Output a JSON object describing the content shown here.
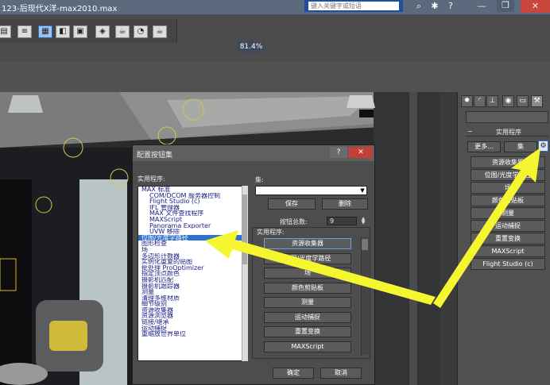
{
  "window": {
    "title_fragment": "123-后现代X洋-max2010.max",
    "search_placeholder": "键入关键字或短语"
  },
  "toolbar": {
    "zoom": "81.4%"
  },
  "command_panel": {
    "rollout_title": "实用程序",
    "more_label": "更多...",
    "sets_label": "集",
    "buttons": [
      "资源收集器",
      "位图/光度学路径",
      "场",
      "颜色剪贴板",
      "测量",
      "运动捕捉",
      "重置变换",
      "MAXScript",
      "Flight Studio (c)"
    ]
  },
  "dialog": {
    "title": "配置按钮集",
    "utilities_label": "实用程序:",
    "sets_label": "集:",
    "save_label": "保存",
    "delete_label": "删除",
    "total_buttons_label": "按钮总数:",
    "total_buttons_value": "9",
    "utilities_group_label": "实用程序:",
    "utility_list": [
      "MAX 标准",
      "COM/DCOM 服务器控制",
      "Flight Studio (c)",
      "IFL 管理器",
      "MAX 文件查找程序",
      "MAXScript",
      "Panorama Exporter",
      "UVW 移除",
      "位图/光度学路径",
      "图形检查",
      "场",
      "多边形计数器",
      "实例化重复的贴图",
      "批处理 ProOptimizer",
      "指定顶点颜色",
      "摄影机匹配",
      "摄影机跟踪器",
      "测量",
      "清理多维材质",
      "细节级别",
      "资源收集器",
      "资源浏览器",
      "链接/继承",
      "运动捕捉",
      "重缩放世界单位"
    ],
    "selected_index": 8,
    "slot_buttons": [
      "资源收集器",
      "位图/光度学路径",
      "场",
      "颜色剪贴板",
      "测量",
      "运动捕捉",
      "重置变换",
      "MAXScript"
    ],
    "ok_label": "确定",
    "cancel_label": "取消"
  },
  "colors": {
    "highlight": "#3271cf",
    "arrow": "#f5f530"
  }
}
